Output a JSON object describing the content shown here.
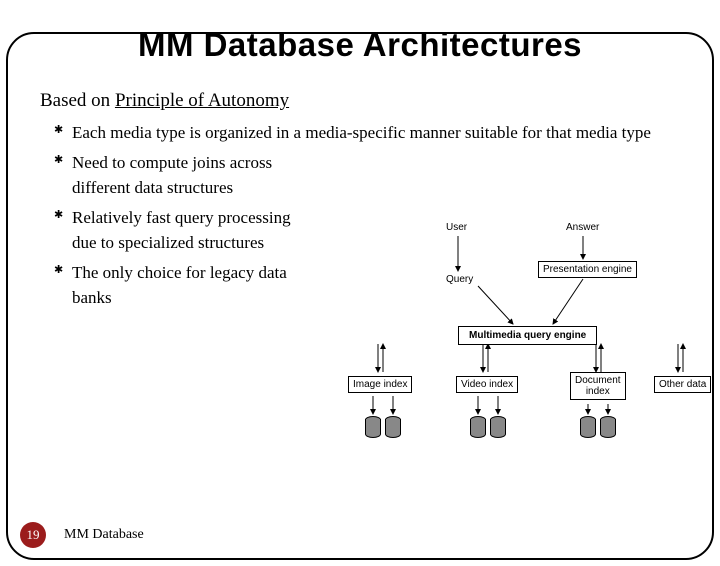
{
  "title": "MM Database Architectures",
  "subtitle_prefix": "Based on ",
  "subtitle_underlined": "Principle of Autonomy",
  "bullets": [
    "Each media type is organized in a media-specific manner suitable for that media type",
    "Need to compute joins across different data structures",
    "Relatively fast query processing due to specialized structures",
    "The only choice for legacy data banks"
  ],
  "footer": {
    "page_number": "19",
    "label": "MM Database"
  },
  "diagram": {
    "user": "User",
    "answer": "Answer",
    "query": "Query",
    "presentation_engine": "Presentation engine",
    "mm_query_engine": "Multimedia query engine",
    "image_index": "Image index",
    "video_index": "Video index",
    "document_index_l1": "Document",
    "document_index_l2": "index",
    "other_data": "Other data"
  }
}
